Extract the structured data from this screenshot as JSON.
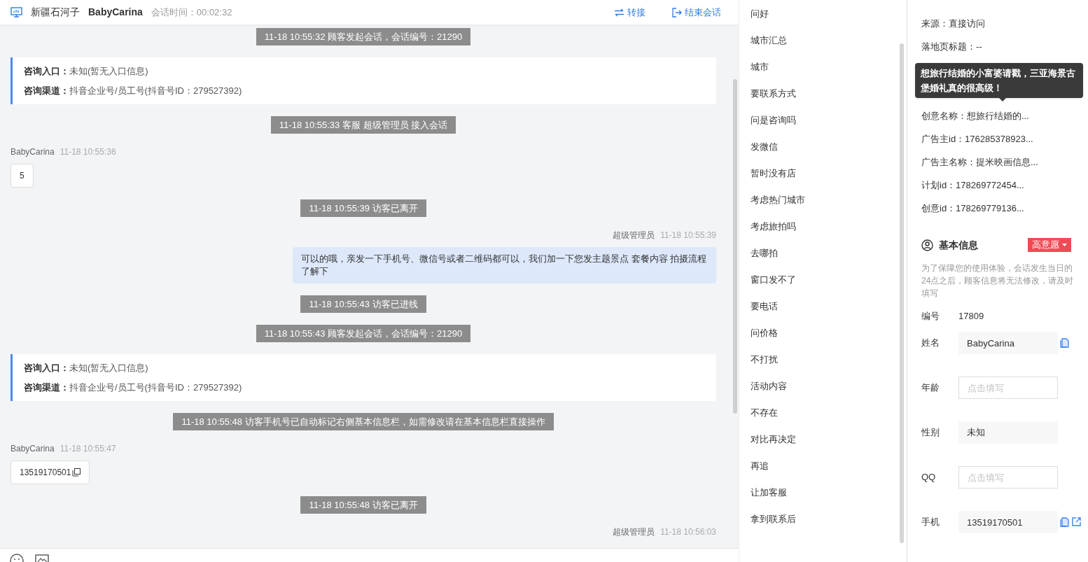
{
  "header": {
    "location": "新疆石河子",
    "visitor": "BabyCarina",
    "duration_label": "会话时间：00:02:32",
    "actions": [
      {
        "kind": "transfer",
        "label": "转接"
      },
      {
        "kind": "end",
        "label": "结束会话"
      }
    ]
  },
  "messages": [
    {
      "kind": "system",
      "text": "11-18 10:55:32 顾客发起会话，会话编号：21290"
    },
    {
      "kind": "info",
      "lines": [
        {
          "label": "咨询入口：",
          "value": "未知(暂无入口信息)"
        },
        {
          "label": "咨询渠道：",
          "value": "抖音企业号/员工号(抖音号ID：279527392)"
        }
      ]
    },
    {
      "kind": "system",
      "text": "11-18 10:55:33 客服 超级管理员 接入会话"
    },
    {
      "kind": "visitor",
      "name": "BabyCarina",
      "time": "11-18 10:55:36",
      "text": "5",
      "copy": false
    },
    {
      "kind": "system",
      "text": "11-18 10:55:39 访客已离开"
    },
    {
      "kind": "agent",
      "name": "超级管理员",
      "time": "11-18 10:55:39",
      "text": "可以的哦，亲发一下手机号、微信号或者二维码都可以，我们加一下您发主题景点 套餐内容 拍摄流程了解下"
    },
    {
      "kind": "system",
      "text": "11-18 10:55:43 访客已进线"
    },
    {
      "kind": "system",
      "text": "11-18 10:55:43 顾客发起会话，会话编号：21290"
    },
    {
      "kind": "info",
      "lines": [
        {
          "label": "咨询入口：",
          "value": "未知(暂无入口信息)"
        },
        {
          "label": "咨询渠道：",
          "value": "抖音企业号/员工号(抖音号ID：279527392)"
        }
      ]
    },
    {
      "kind": "system",
      "text": "11-18 10:55:48 访客手机号已自动标记右侧基本信息栏，如需修改请在基本信息栏直接操作"
    },
    {
      "kind": "visitor",
      "name": "BabyCarina",
      "time": "11-18 10:55:47",
      "text": "13519170501",
      "copy": true
    },
    {
      "kind": "system",
      "text": "11-18 10:55:48 访客已离开"
    },
    {
      "kind": "agent",
      "name": "超级管理员",
      "time": "11-18 10:56:03"
    }
  ],
  "quick_replies": [
    "问好",
    "城市汇总",
    "城市",
    "要联系方式",
    "问是咨询吗",
    "发微信",
    "暂时没有店",
    "考虑热门城市",
    "考虑旅拍吗",
    "去哪拍",
    "窗口发不了",
    "要电话",
    "问价格",
    "不打扰",
    "活动内容",
    "不存在",
    "对比再决定",
    "再追",
    "让加客服",
    "拿到联系后"
  ],
  "source_info": {
    "above_tooltip": [
      "来源：直接访问",
      "落地页标题：--"
    ],
    "below_tooltip": [
      "创意名称：想旅行结婚的...",
      "广告主id：176285378923...",
      "广告主名称：提米映画信息...",
      "计划id：178269772454...",
      "创意id：178269779136..."
    ]
  },
  "tooltip": "想旅行结婚的小富婆请戳，三亚海景古堡婚礼真的很高级！",
  "basic_info": {
    "title": "基本信息",
    "intent_tag": "高意愿",
    "notice": "为了保障您的使用体验，会话发生当日的24点之后，顾客信息将无法修改，请及时填写",
    "id_label": "编号",
    "id_value": "17809",
    "fields": [
      {
        "label": "姓名",
        "value": "BabyCarina",
        "copy": true,
        "open": false
      },
      {
        "label": "年龄",
        "placeholder": "点击填写",
        "copy": false,
        "open": false
      },
      {
        "label": "性别",
        "value": "未知",
        "copy": false,
        "open": false
      },
      {
        "label": "QQ",
        "placeholder": "点击填写",
        "copy": false,
        "open": false
      },
      {
        "label": "手机",
        "value": "13519170501",
        "copy": true,
        "open": true
      }
    ]
  }
}
